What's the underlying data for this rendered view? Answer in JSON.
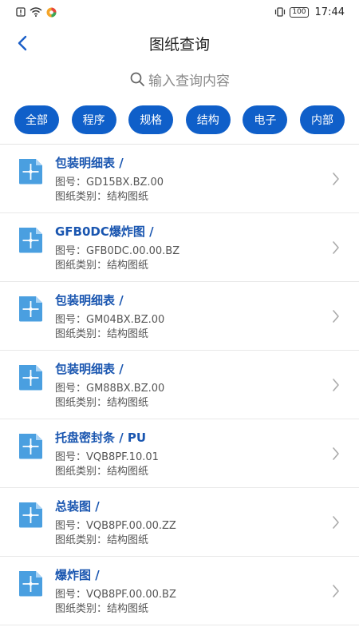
{
  "status_bar": {
    "battery": "100",
    "time": "17:44",
    "icons": [
      "sim-alert-icon",
      "wifi-icon",
      "app-notification-icon",
      "vibrate-icon",
      "battery-icon"
    ]
  },
  "header": {
    "title": "图纸查询",
    "back_icon": "chevron-left-icon"
  },
  "search": {
    "placeholder": "输入查询内容",
    "icon": "search-icon"
  },
  "filters": [
    "全部",
    "程序",
    "规格",
    "结构",
    "电子",
    "内部"
  ],
  "drawings": [
    {
      "title": "包装明细表 /",
      "number_line": "图号：GD15BX.BZ.00",
      "type_line": "图纸类别：结构图纸"
    },
    {
      "title": "GFB0DC爆炸图 /",
      "number_line": "图号：GFB0DC.00.00.BZ",
      "type_line": "图纸类别：结构图纸"
    },
    {
      "title": "包装明细表 /",
      "number_line": "图号：GM04BX.BZ.00",
      "type_line": "图纸类别：结构图纸"
    },
    {
      "title": "包装明细表 /",
      "number_line": "图号：GM88BX.BZ.00",
      "type_line": "图纸类别：结构图纸"
    },
    {
      "title": "托盘密封条 / PU",
      "number_line": "图号：VQB8PF.10.01",
      "type_line": "图纸类别：结构图纸"
    },
    {
      "title": "总装图 /",
      "number_line": "图号：VQB8PF.00.00.ZZ",
      "type_line": "图纸类别：结构图纸"
    },
    {
      "title": "爆炸图 /",
      "number_line": "图号：VQB8PF.00.00.BZ",
      "type_line": "图纸类别：结构图纸"
    }
  ],
  "colors": {
    "accent": "#0f5fc9",
    "title_text": "#1a56b0",
    "icon_fill": "#4a9fe0"
  }
}
